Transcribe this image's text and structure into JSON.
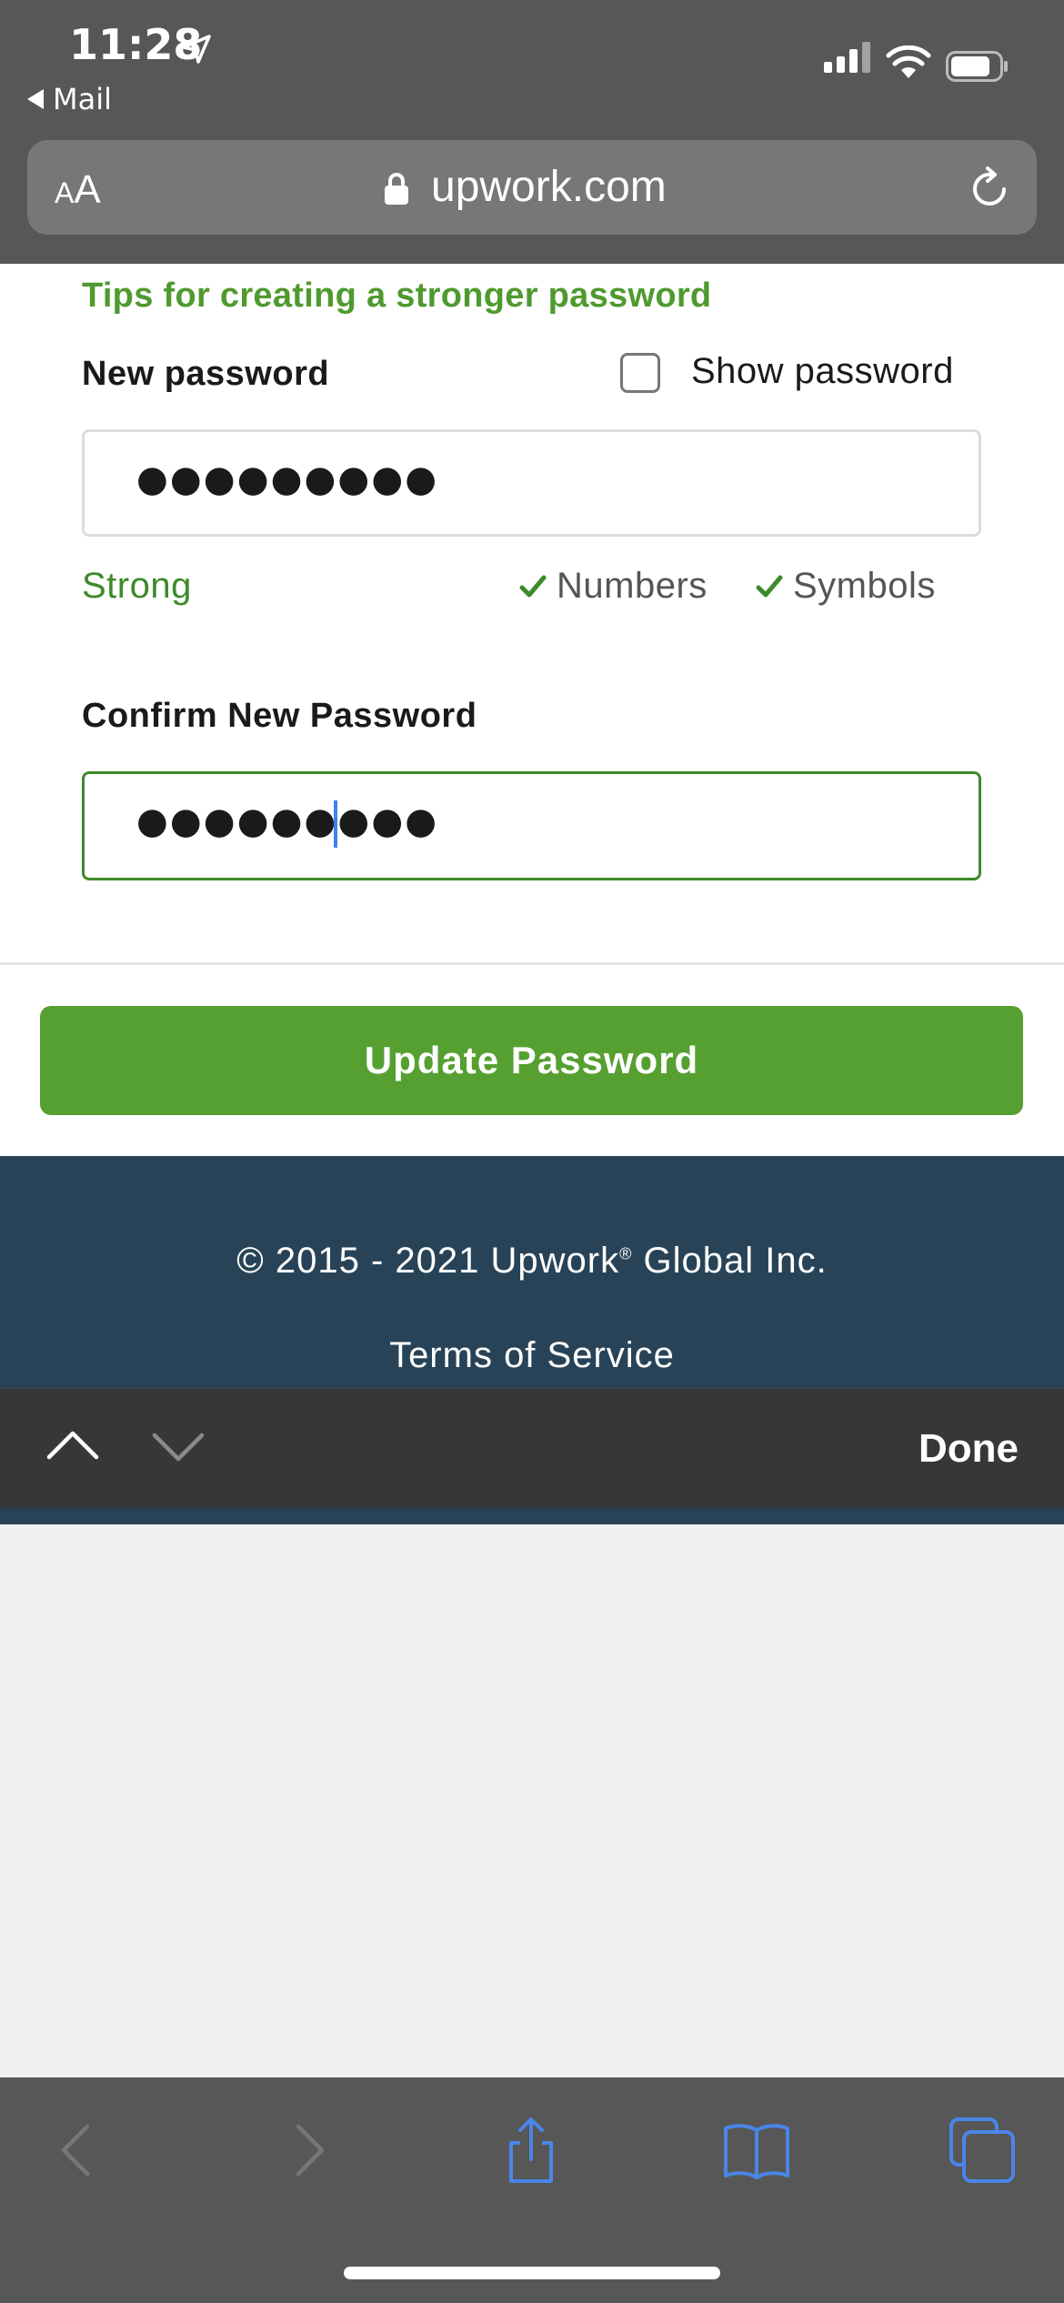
{
  "status_bar": {
    "time": "11:28",
    "back_app": "Mail"
  },
  "browser": {
    "text_size_small": "A",
    "text_size_large": "A",
    "domain": "upwork.com"
  },
  "form": {
    "tips_link": "Tips for creating a stronger password",
    "new_password_label": "New password",
    "show_password_label": "Show password",
    "show_password_checked": false,
    "new_password_value": "●●●●●●●●●",
    "strength": "Strong",
    "check_numbers": "Numbers",
    "check_symbols": "Symbols",
    "confirm_label": "Confirm New Password",
    "confirm_password_value": "●●●●●●●●●",
    "submit_label": "Update Password"
  },
  "footer": {
    "copyright_prefix": "© 2015 - 2021 Upwork",
    "copyright_mark": "®",
    "copyright_suffix": " Global Inc.",
    "terms": "Terms of Service"
  },
  "keyboard_bar": {
    "done_label": "Done"
  },
  "toolbar": {
    "icons": [
      "back-icon",
      "forward-icon",
      "share-icon",
      "bookmarks-icon",
      "tabs-icon"
    ]
  },
  "colors": {
    "accent_green": "#55a030",
    "link_green": "#4f9a2f",
    "footer_navy": "#284357",
    "toolbar_blue_icon": "#4a86e8",
    "chrome_gray": "#575757"
  }
}
